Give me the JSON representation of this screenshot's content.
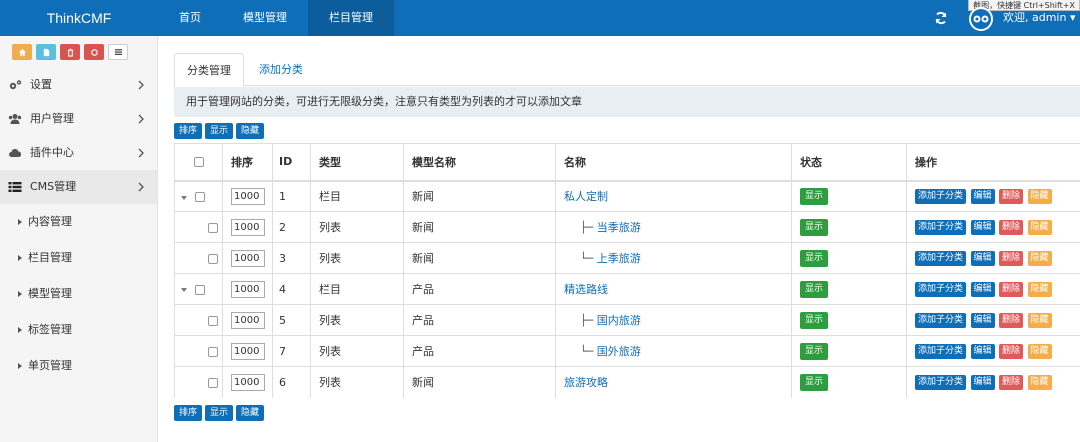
{
  "header": {
    "brand": "ThinkCMF",
    "nav": [
      "首页",
      "模型管理",
      "栏目管理"
    ],
    "active_nav": 2,
    "tooltip": "截图，快捷键 Ctrl+Shift+X",
    "welcome": "欢迎, admin ▾"
  },
  "sidebar": {
    "items": [
      {
        "label": "设置",
        "icon": "gears-icon"
      },
      {
        "label": "用户管理",
        "icon": "users-icon"
      },
      {
        "label": "插件中心",
        "icon": "cloud-icon"
      },
      {
        "label": "CMS管理",
        "icon": "list-icon"
      }
    ],
    "subitems": [
      "内容管理",
      "栏目管理",
      "模型管理",
      "标签管理",
      "单页管理"
    ]
  },
  "tabs": [
    "分类管理",
    "添加分类"
  ],
  "notice": "用于管理网站的分类，可进行无限级分类，注意只有类型为列表的才可以添加文章",
  "buttons": {
    "sort": "排序",
    "show": "显示",
    "hide": "隐藏"
  },
  "table": {
    "headers": [
      "排序",
      "ID",
      "类型",
      "模型名称",
      "名称",
      "状态",
      "操作"
    ],
    "ops": [
      "添加子分类",
      "编辑",
      "删除",
      "隐藏"
    ],
    "rows": [
      {
        "sort": "1000",
        "id": "1",
        "type": "栏目",
        "model": "新闻",
        "tree": "",
        "name": "私人定制",
        "status": "显示"
      },
      {
        "sort": "1000",
        "id": "2",
        "type": "列表",
        "model": "新闻",
        "tree": "├─",
        "name": "当季旅游",
        "status": "显示"
      },
      {
        "sort": "1000",
        "id": "3",
        "type": "列表",
        "model": "新闻",
        "tree": "└─",
        "name": "上季旅游",
        "status": "显示"
      },
      {
        "sort": "1000",
        "id": "4",
        "type": "栏目",
        "model": "产品",
        "tree": "",
        "name": "精选路线",
        "status": "显示"
      },
      {
        "sort": "1000",
        "id": "5",
        "type": "列表",
        "model": "产品",
        "tree": "├─",
        "name": "国内旅游",
        "status": "显示"
      },
      {
        "sort": "1000",
        "id": "7",
        "type": "列表",
        "model": "产品",
        "tree": "└─",
        "name": "国外旅游",
        "status": "显示"
      },
      {
        "sort": "1000",
        "id": "6",
        "type": "列表",
        "model": "新闻",
        "tree": "",
        "name": "旅游攻略",
        "status": "显示"
      }
    ]
  }
}
